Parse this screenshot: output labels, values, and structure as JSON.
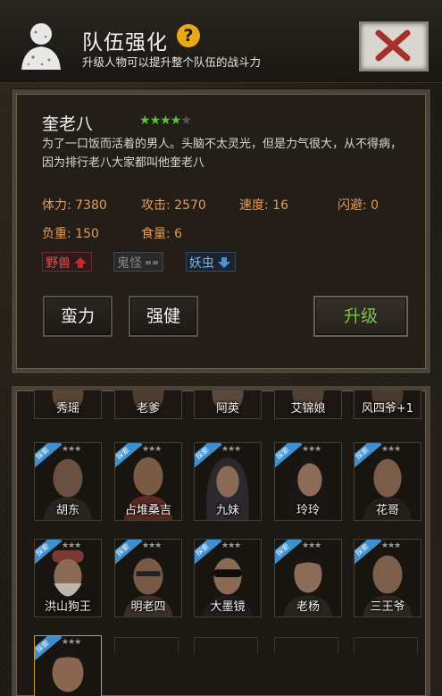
{
  "header": {
    "title": "队伍强化",
    "help_symbol": "?",
    "subtitle": "升级人物可以提升整个队伍的战斗力",
    "colors": {
      "help": "#e8a818",
      "close_x": "#a5322a"
    }
  },
  "hero": {
    "name": "奎老八",
    "stars_filled": 4,
    "stars_total": 5,
    "description": "为了一口饭而活着的男人。头脑不太灵光，但是力气很大，从不得病，因为排行老八大家都叫他奎老八",
    "stats": {
      "hp": "体力: 7380",
      "attack": "攻击: 2570",
      "speed": "速度: 16",
      "dodge": "闪避: 0",
      "load": "负重: 150",
      "food": "食量: 6"
    },
    "traits": [
      {
        "label": "野兽",
        "icon": "arrow-up-icon",
        "color": "#e05050"
      },
      {
        "label": "鬼怪",
        "icon": "dash-icon",
        "color": "#888888"
      },
      {
        "label": "妖虫",
        "icon": "arrow-down-icon",
        "color": "#7fb4e0"
      }
    ],
    "buttons": {
      "skill1": "蛮力",
      "skill2": "强健",
      "upgrade": "升级"
    }
  },
  "roster": {
    "row1": [
      "秀瑶",
      "老爹",
      "阿英",
      "艾锦娘",
      "风四爷+1"
    ],
    "row2": [
      "胡东",
      "占堆桑吉",
      "九妹",
      "玲玲",
      "花哥"
    ],
    "row3": [
      "洪山狗王",
      "明老四",
      "大墨镜",
      "老杨",
      "三王爷"
    ],
    "badge": "探索",
    "star_mark": "★★★"
  }
}
